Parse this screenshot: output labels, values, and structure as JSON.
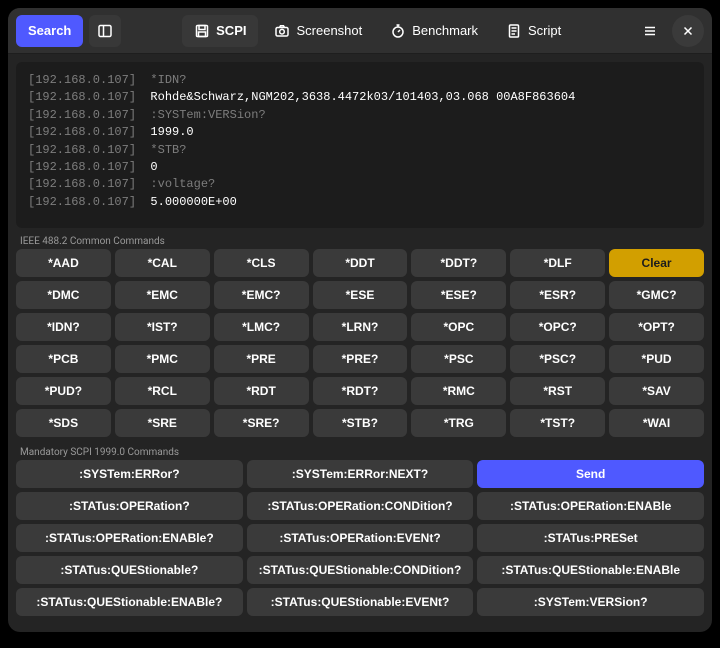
{
  "header": {
    "search_label": "Search",
    "tabs": {
      "scpi": "SCPI",
      "screenshot": "Screenshot",
      "benchmark": "Benchmark",
      "script": "Script"
    }
  },
  "terminal": {
    "ip": "[192.168.0.107]",
    "lines": [
      {
        "kind": "sent",
        "text": "*IDN?"
      },
      {
        "kind": "recv",
        "text": "Rohde&Schwarz,NGM202,3638.4472k03/101403,03.068 00A8F863604"
      },
      {
        "kind": "sent",
        "text": ":SYSTem:VERSion?"
      },
      {
        "kind": "recv",
        "text": "1999.0"
      },
      {
        "kind": "sent",
        "text": "*STB?"
      },
      {
        "kind": "recv",
        "text": "0"
      },
      {
        "kind": "sent",
        "text": ":voltage?"
      },
      {
        "kind": "recv",
        "text": "5.000000E+00"
      }
    ]
  },
  "sections": {
    "ieee_label": "IEEE 488.2 Common Commands",
    "ieee_cmds": [
      "*AAD",
      "*CAL",
      "*CLS",
      "*DDT",
      "*DDT?",
      "*DLF",
      "Clear",
      "*DMC",
      "*EMC",
      "*EMC?",
      "*ESE",
      "*ESE?",
      "*ESR?",
      "*GMC?",
      "*IDN?",
      "*IST?",
      "*LMC?",
      "*LRN?",
      "*OPC",
      "*OPC?",
      "*OPT?",
      "*PCB",
      "*PMC",
      "*PRE",
      "*PRE?",
      "*PSC",
      "*PSC?",
      "*PUD",
      "*PUD?",
      "*RCL",
      "*RDT",
      "*RDT?",
      "*RMC",
      "*RST",
      "*SAV",
      "*SDS",
      "*SRE",
      "*SRE?",
      "*STB?",
      "*TRG",
      "*TST?",
      "*WAI"
    ],
    "scpi_label": "Mandatory SCPI 1999.0 Commands",
    "scpi_cmds": [
      ":SYSTem:ERRor?",
      ":SYSTem:ERRor:NEXT?",
      "Send",
      ":STATus:OPERation?",
      ":STATus:OPERation:CONDition?",
      ":STATus:OPERation:ENABle",
      ":STATus:OPERation:ENABle?",
      ":STATus:OPERation:EVENt?",
      ":STATus:PRESet",
      ":STATus:QUEStionable?",
      ":STATus:QUEStionable:CONDition?",
      ":STATus:QUEStionable:ENABle",
      ":STATus:QUEStionable:ENABle?",
      ":STATus:QUEStionable:EVENt?",
      ":SYSTem:VERSion?"
    ]
  },
  "accent": {
    "primary": "#4f59ff",
    "warning": "#d29f00"
  }
}
